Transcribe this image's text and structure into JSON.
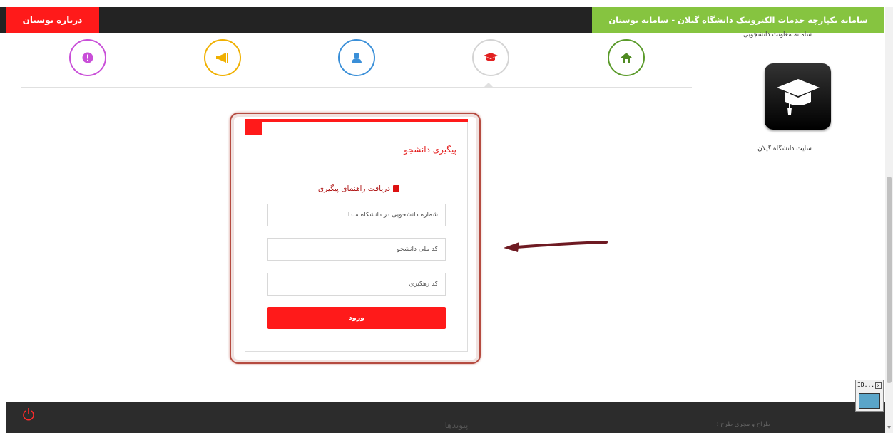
{
  "header": {
    "title": "سامانه یکپارچه خدمات الکترونیک دانشگاه گیلان - سامانه بوستان",
    "about_label": "درباره بوستان",
    "title_color": "#86c440",
    "about_color": "#ff1a1a"
  },
  "steps": [
    {
      "icon": "exclamation-icon",
      "color": "#c94fd8"
    },
    {
      "icon": "megaphone-icon",
      "color": "#f0b000"
    },
    {
      "icon": "user-icon",
      "color": "#3a8fd8"
    },
    {
      "icon": "graduation-cap-icon",
      "color": "#cccccc",
      "active": true
    },
    {
      "icon": "home-icon",
      "color": "#5a9a2a"
    }
  ],
  "sidebar": {
    "top_label": "سامانه معاونت دانشجویی",
    "uni_label": "سایت دانشگاه گیلان"
  },
  "form": {
    "title": "پیگیری دانشجو",
    "guide_link": "دریافت راهنمای پیگیری",
    "student_number_placeholder": "شماره دانشجویی در دانشگاه مبدا",
    "national_code_placeholder": "کد ملی دانشجو",
    "tracking_code_placeholder": "کد رهگیری",
    "submit_label": "ورود",
    "accent_color": "#ff1a1a"
  },
  "footer": {
    "links_title": "پیوندها",
    "designer_label": "طراح و مجری طرح :"
  },
  "widget": {
    "title": "ID..."
  }
}
